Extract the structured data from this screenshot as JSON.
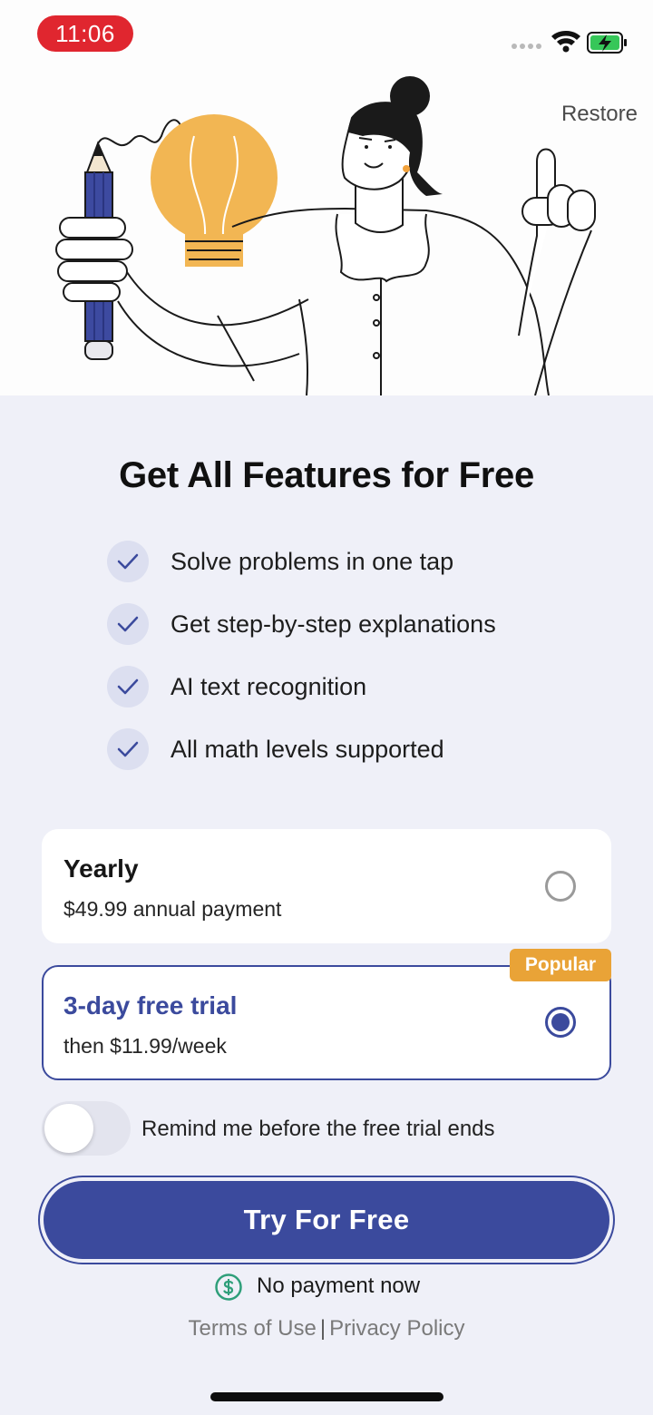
{
  "status_bar": {
    "time": "11:06",
    "wifi_icon": "wifi-icon",
    "battery_icon": "battery-charging-icon",
    "signal_icon": "signal-dots-icon"
  },
  "header": {
    "restore_label": "Restore",
    "illustration": "woman-with-pencil-and-lightbulb-illustration"
  },
  "main": {
    "title": "Get All Features for Free",
    "features": [
      {
        "label": "Solve problems in one tap",
        "icon": "check-icon"
      },
      {
        "label": "Get step-by-step explanations",
        "icon": "check-icon"
      },
      {
        "label": "AI text recognition",
        "icon": "check-icon"
      },
      {
        "label": "All math levels supported",
        "icon": "check-icon"
      }
    ]
  },
  "plans": [
    {
      "name": "Yearly",
      "price": "$49.99 annual payment",
      "selected": false
    },
    {
      "name": "3-day free trial",
      "price": "then $11.99/week",
      "selected": true,
      "badge": "Popular"
    }
  ],
  "reminder": {
    "label": "Remind me before the free trial ends",
    "enabled": false
  },
  "cta": {
    "label": "Try For Free",
    "note": "No payment now",
    "note_icon": "dollar-circle-icon"
  },
  "footer": {
    "terms": "Terms of Use",
    "separator": "|",
    "privacy": "Privacy Policy"
  },
  "colors": {
    "accent": "#3b4a9d",
    "badge": "#e9a337",
    "background": "#eff0f8",
    "time_pill": "#e0262f",
    "note_icon": "#2f9f7a"
  }
}
